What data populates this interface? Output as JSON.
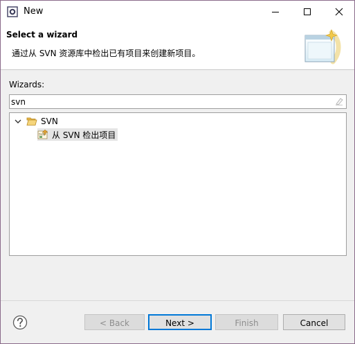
{
  "window": {
    "title": "New"
  },
  "banner": {
    "title": "Select a wizard",
    "description": "通过从 SVN 资源库中检出已有项目来创建新项目。"
  },
  "wizards": {
    "label": "Wizards:",
    "filter_value": "svn",
    "tree": [
      {
        "label": "SVN",
        "expanded": true,
        "icon": "folder-open-icon",
        "children": [
          {
            "label": "从 SVN 检出项目",
            "icon": "svn-checkout-icon",
            "selected": true
          }
        ]
      }
    ]
  },
  "buttons": {
    "back": "< Back",
    "next": "Next >",
    "finish": "Finish",
    "cancel": "Cancel"
  },
  "icons": [
    "app-icon",
    "minimize-icon",
    "maximize-icon",
    "close-icon",
    "wizard-banner-icon",
    "clear-filter-icon",
    "expand-arrow-icon",
    "folder-open-icon",
    "svn-checkout-icon",
    "help-icon"
  ],
  "colors": {
    "accent": "#0078d7",
    "window_border": "#8a6a8a"
  }
}
